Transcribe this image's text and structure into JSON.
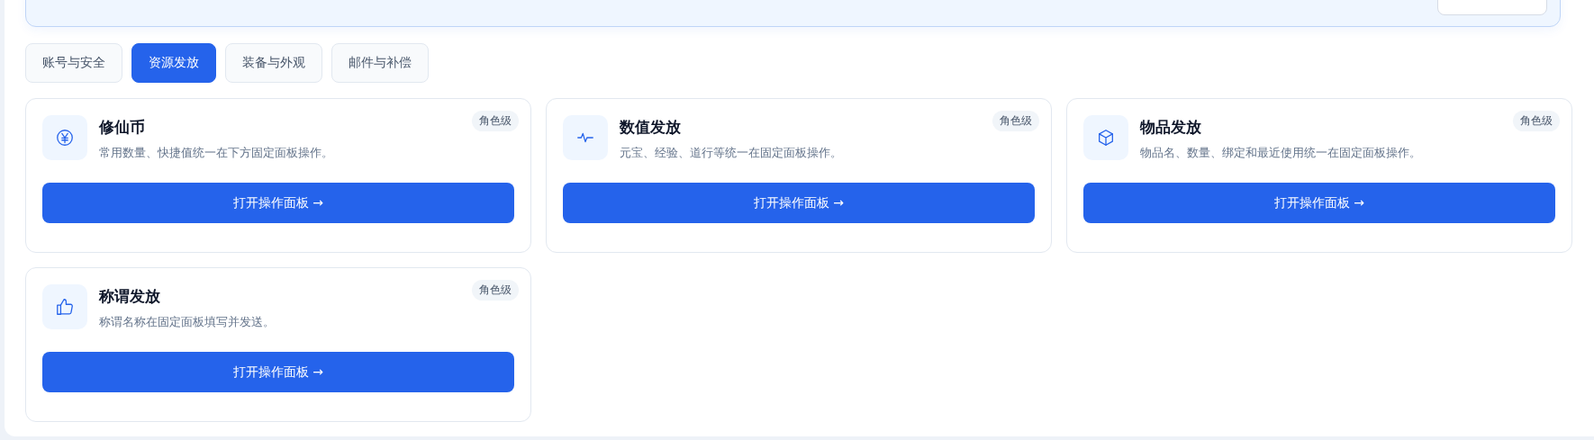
{
  "tabs": [
    {
      "label": "账号与安全",
      "selected": false
    },
    {
      "label": "资源发放",
      "selected": true
    },
    {
      "label": "装备与外观",
      "selected": false
    },
    {
      "label": "邮件与补偿",
      "selected": false
    }
  ],
  "cards": [
    {
      "title": "修仙币",
      "description": "常用数量、快捷值统一在下方固定面板操作。",
      "badge": "角色级",
      "button": "打开操作面板 →"
    },
    {
      "title": "数值发放",
      "description": "元宝、经验、道行等统一在固定面板操作。",
      "badge": "角色级",
      "button": "打开操作面板 →"
    },
    {
      "title": "物品发放",
      "description": "物品名、数量、绑定和最近使用统一在固定面板操作。",
      "badge": "角色级",
      "button": "打开操作面板 →"
    },
    {
      "title": "称谓发放",
      "description": "称谓名称在固定面板填写并发送。",
      "badge": "角色级",
      "button": "打开操作面板 →"
    }
  ]
}
